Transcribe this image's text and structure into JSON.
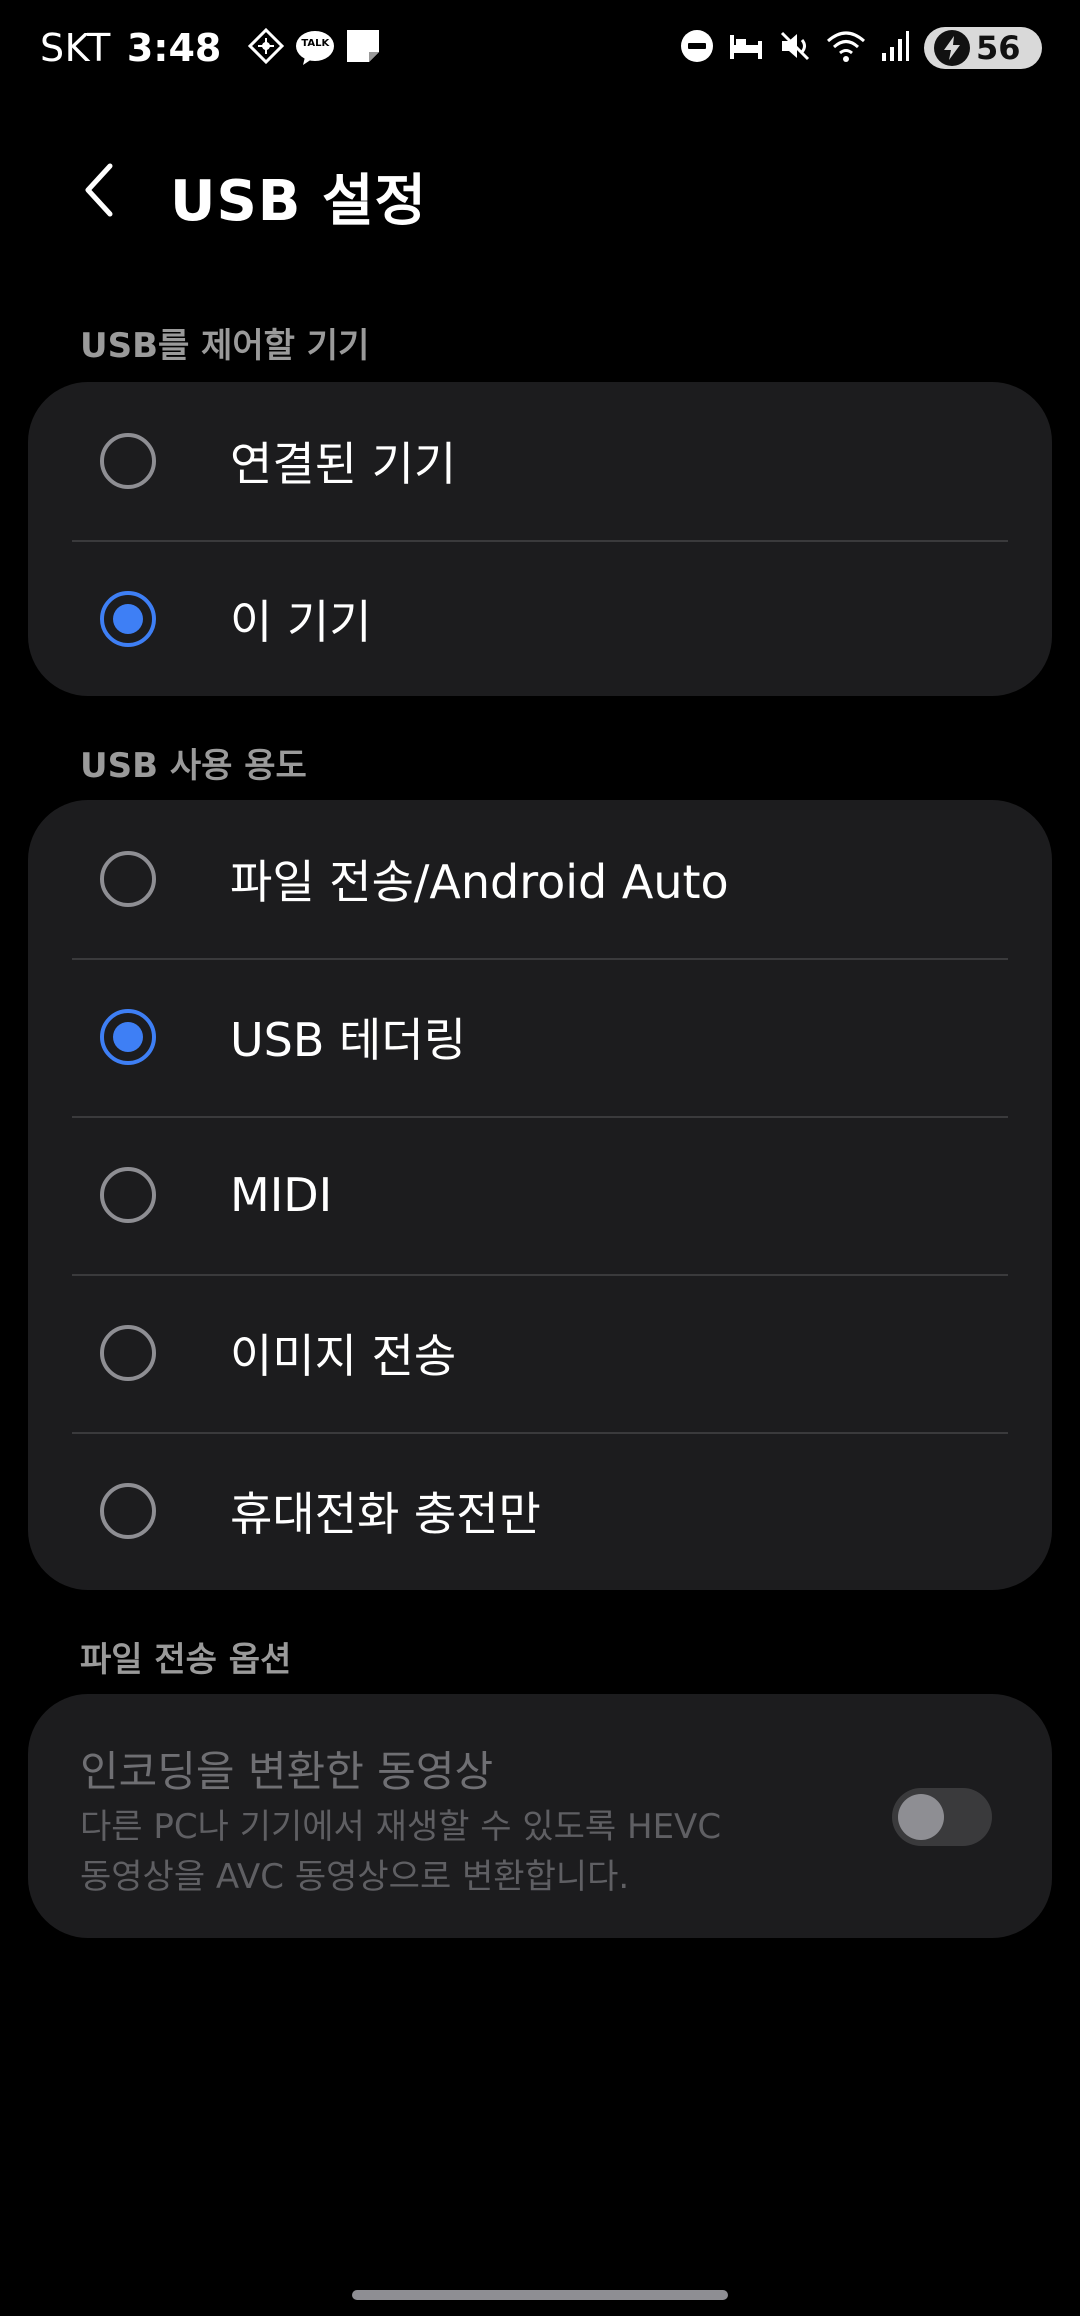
{
  "status_bar": {
    "carrier": "SKT",
    "time": "3:48",
    "battery": "56",
    "icons": [
      "navigation-icon",
      "kakaotalk-icon",
      "note-icon",
      "dnd-icon",
      "bed-icon",
      "mute-icon",
      "wifi-icon",
      "signal-icon",
      "charging-icon"
    ],
    "kakao_label": "TALK"
  },
  "header": {
    "title": "USB 설정"
  },
  "sections": {
    "control": {
      "label": "USB를 제어할 기기",
      "options": [
        {
          "label": "연결된 기기",
          "checked": false
        },
        {
          "label": "이 기기",
          "checked": true
        }
      ]
    },
    "usage": {
      "label": "USB 사용 용도",
      "options": [
        {
          "label": "파일 전송/Android Auto",
          "checked": false
        },
        {
          "label": "USB 테더링",
          "checked": true
        },
        {
          "label": "MIDI",
          "checked": false
        },
        {
          "label": "이미지 전송",
          "checked": false
        },
        {
          "label": "휴대전화 충전만",
          "checked": false
        }
      ]
    },
    "file_options": {
      "label": "파일 전송 옵션",
      "toggle_title": "인코딩을 변환한 동영상",
      "toggle_desc_line1": "다른 PC나 기기에서 재생할 수 있도록 HEVC",
      "toggle_desc_line2": "동영상을 AVC 동영상으로 변환합니다.",
      "toggle_on": false
    }
  },
  "colors": {
    "accent": "#3e7ff5",
    "card": "#1c1c1e",
    "section_label": "#9a9a9a"
  }
}
